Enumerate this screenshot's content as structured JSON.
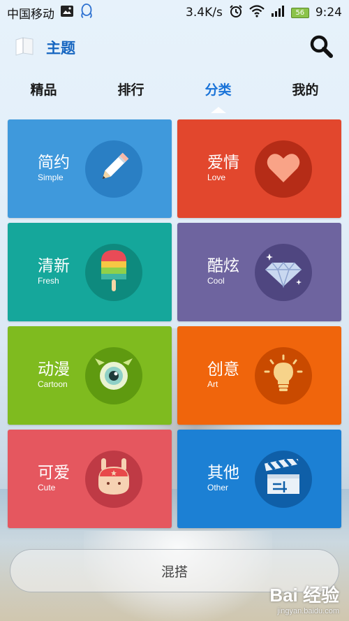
{
  "status_bar": {
    "carrier": "中国移动",
    "speed": "3.4K/s",
    "battery_label": "56",
    "time": "9:24"
  },
  "header": {
    "title": "主题"
  },
  "tabs": [
    {
      "label": "精品",
      "active": false
    },
    {
      "label": "排行",
      "active": false
    },
    {
      "label": "分类",
      "active": true
    },
    {
      "label": "我的",
      "active": false
    }
  ],
  "categories": [
    {
      "title": "简约",
      "subtitle": "Simple",
      "color": "#3f99dc",
      "circle": "#2a7fc4",
      "icon": "pencil-icon"
    },
    {
      "title": "爱情",
      "subtitle": "Love",
      "color": "#e2472d",
      "circle": "#b52c17",
      "icon": "heart-icon"
    },
    {
      "title": "清新",
      "subtitle": "Fresh",
      "color": "#15a79b",
      "circle": "#0e8a7e",
      "icon": "popsicle-icon"
    },
    {
      "title": "酷炫",
      "subtitle": "Cool",
      "color": "#6e649f",
      "circle": "#4f4680",
      "icon": "diamond-icon"
    },
    {
      "title": "动漫",
      "subtitle": "Cartoon",
      "color": "#7fbb1f",
      "circle": "#5f9a10",
      "icon": "one-eyed-monster-icon"
    },
    {
      "title": "创意",
      "subtitle": "Art",
      "color": "#f0650c",
      "circle": "#c94a00",
      "icon": "lightbulb-icon"
    },
    {
      "title": "可爱",
      "subtitle": "Cute",
      "color": "#e5575f",
      "circle": "#bf3a45",
      "icon": "cute-bunny-icon"
    },
    {
      "title": "其他",
      "subtitle": "Other",
      "color": "#1c80d4",
      "circle": "#0f5fa8",
      "icon": "clapperboard-icon"
    }
  ],
  "bottom_button": {
    "label": "混搭"
  },
  "watermark": {
    "main": "Bai 经验",
    "sub": "jingyan.baidu.com"
  }
}
